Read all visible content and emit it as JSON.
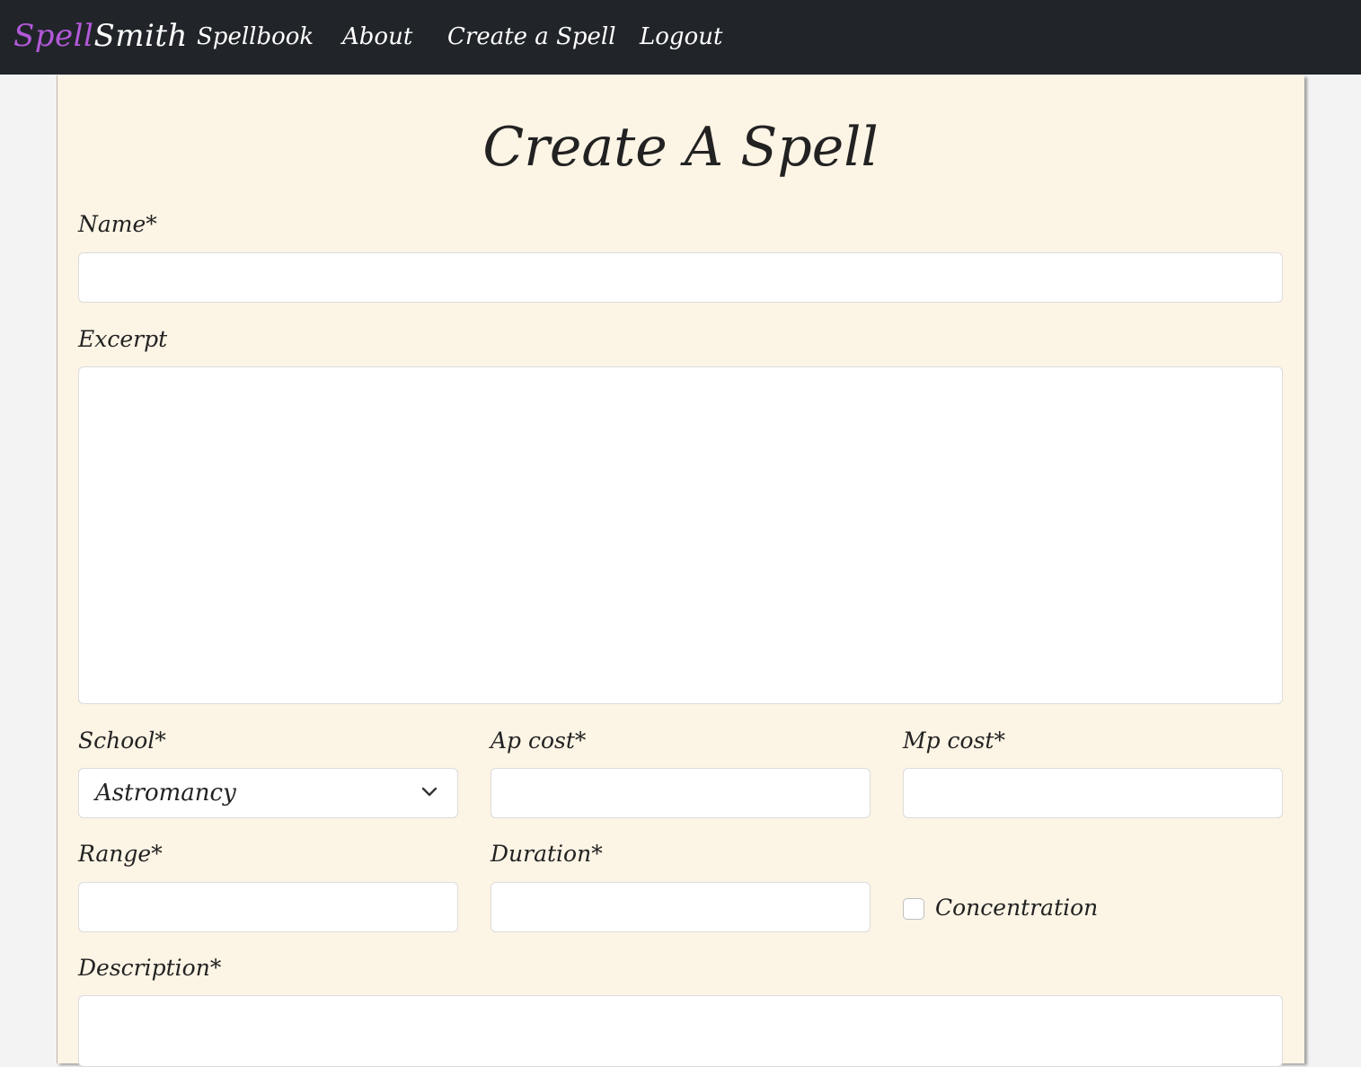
{
  "navbar": {
    "brand_part1": "Spell",
    "brand_part2": "Smith",
    "links": [
      "Spellbook",
      "About",
      "Create a Spell",
      "Logout"
    ]
  },
  "form": {
    "title": "Create A Spell",
    "name_label": "Name*",
    "name_value": "",
    "excerpt_label": "Excerpt",
    "excerpt_value": "",
    "school_label": "School*",
    "school_selected": "Astromancy",
    "ap_cost_label": "Ap cost*",
    "ap_cost_value": "",
    "mp_cost_label": "Mp cost*",
    "mp_cost_value": "",
    "range_label": "Range*",
    "range_value": "",
    "duration_label": "Duration*",
    "duration_value": "",
    "concentration_label": "Concentration",
    "concentration_checked": false,
    "description_label": "Description*",
    "description_value": ""
  },
  "colors": {
    "navbar_bg": "#212529",
    "brand_accent": "#b259d9",
    "card_bg": "#fcf4e5",
    "page_bg": "#f3f3f3"
  },
  "icons": {
    "school_dropdown": "chevron-down-icon"
  }
}
